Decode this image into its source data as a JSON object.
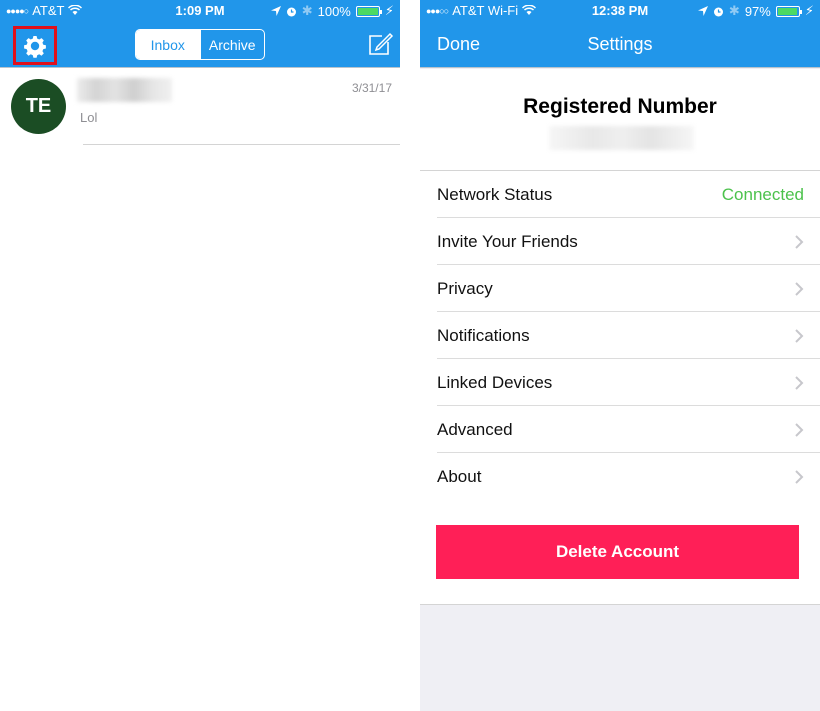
{
  "left_screen": {
    "status_bar": {
      "signal_dots": "●●●●○",
      "carrier": "AT&T",
      "time": "1:09 PM",
      "battery": "100%",
      "battery_level": 1.0
    },
    "nav": {
      "tabs": [
        {
          "label": "Inbox",
          "selected": true
        },
        {
          "label": "Archive",
          "selected": false
        }
      ],
      "settings_icon": "gear-icon",
      "compose_icon": "compose-icon",
      "highlight_color": "#e0101c"
    },
    "conversations": [
      {
        "initials": "TE",
        "name": "",
        "date": "3/31/17",
        "preview": "Lol",
        "avatar_color": "#1b4d24"
      }
    ]
  },
  "right_screen": {
    "status_bar": {
      "signal_dots": "●●●○○",
      "carrier": "AT&T Wi-Fi",
      "time": "12:38 PM",
      "battery": "97%",
      "battery_level": 0.97
    },
    "nav": {
      "done_label": "Done",
      "title": "Settings"
    },
    "registered": {
      "title": "Registered Number",
      "number": ""
    },
    "rows": [
      {
        "label": "Network Status",
        "value": "Connected"
      },
      {
        "label": "Invite Your Friends"
      },
      {
        "label": "Privacy"
      },
      {
        "label": "Notifications"
      },
      {
        "label": "Linked Devices"
      },
      {
        "label": "Advanced"
      },
      {
        "label": "About"
      }
    ],
    "delete_label": "Delete Account"
  },
  "colors": {
    "nav_bar": "#2196ea",
    "connected": "#4cc24c",
    "delete": "#ff1f57",
    "background": "#efeff4"
  }
}
